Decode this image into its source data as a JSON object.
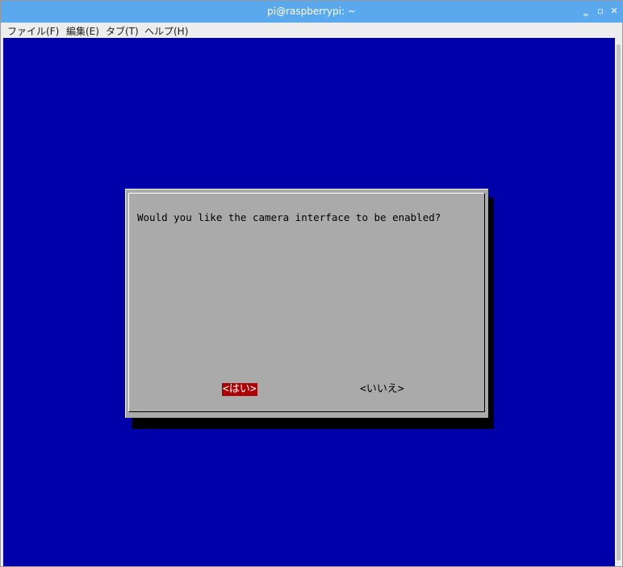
{
  "window": {
    "title": "pi@raspberrypi: ~",
    "controls": {
      "minimize": "‗",
      "maximize": "▫",
      "close": "✕"
    }
  },
  "menubar": {
    "items": [
      {
        "label": "ファイル(F)"
      },
      {
        "label": "編集(E)"
      },
      {
        "label": "タブ(T)"
      },
      {
        "label": "ヘルプ(H)"
      }
    ]
  },
  "dialog": {
    "prompt": "Would you like the camera interface to be enabled?",
    "yes_label": "<はい>",
    "no_label": "<いいえ>"
  },
  "colors": {
    "titlebar": "#5aa9ef",
    "terminal_bg": "#0000aa",
    "dialog_bg": "#aaaaaa",
    "selected_button": "#aa0000"
  }
}
